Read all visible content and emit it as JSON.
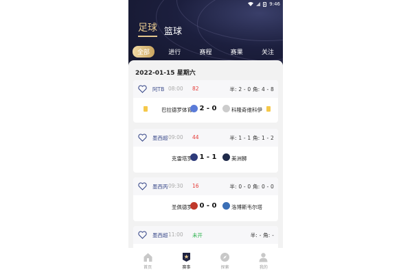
{
  "status": {
    "time": "9:46"
  },
  "sport_tabs": [
    {
      "label": "足球",
      "active": true
    },
    {
      "label": "篮球",
      "active": false
    }
  ],
  "filter_tabs": [
    {
      "label": "全部",
      "active": true
    },
    {
      "label": "进行",
      "active": false
    },
    {
      "label": "赛程",
      "active": false
    },
    {
      "label": "赛果",
      "active": false
    },
    {
      "label": "关注",
      "active": false
    }
  ],
  "date": "2022-01-15 星期六",
  "matches": [
    {
      "league": "阿TB",
      "time": "08:00",
      "minute": "82",
      "half": "半: 2 - 0 角: 4 - 8",
      "home": "巴拉德罗体育",
      "score": "2 - 0",
      "away": "科隆奇维科伊",
      "home_logo_color": "#5a7bd8",
      "away_logo_color": "#cccccc"
    },
    {
      "league": "墨西超",
      "time": "09:00",
      "minute": "44",
      "half": "半: 1 - 1 角: 1 - 2",
      "home": "克雷塔罗",
      "score": "1 - 1",
      "away": "美洲狮",
      "home_logo_color": "#2d3a7a",
      "away_logo_color": "#1f2a4a"
    },
    {
      "league": "墨西丙",
      "time": "09:30",
      "minute": "16",
      "half": "半: 0 - 0 角: 0 - 0",
      "home": "圣佩德罗",
      "score": "0 - 0",
      "away": "洛博斯韦尔塔",
      "home_logo_color": "#c0392b",
      "away_logo_color": "#3b6fb6"
    },
    {
      "league": "墨西超",
      "time": "11:00",
      "minute": "未开",
      "half": "半: - 角: -",
      "home": "",
      "score": "",
      "away": "",
      "home_logo_color": "",
      "away_logo_color": ""
    }
  ],
  "bottom_nav": [
    {
      "label": "首页",
      "icon": "home-icon",
      "active": false
    },
    {
      "label": "赛事",
      "icon": "events-icon",
      "active": true
    },
    {
      "label": "探索",
      "icon": "explore-icon",
      "active": false
    },
    {
      "label": "我的",
      "icon": "profile-icon",
      "active": false
    }
  ]
}
